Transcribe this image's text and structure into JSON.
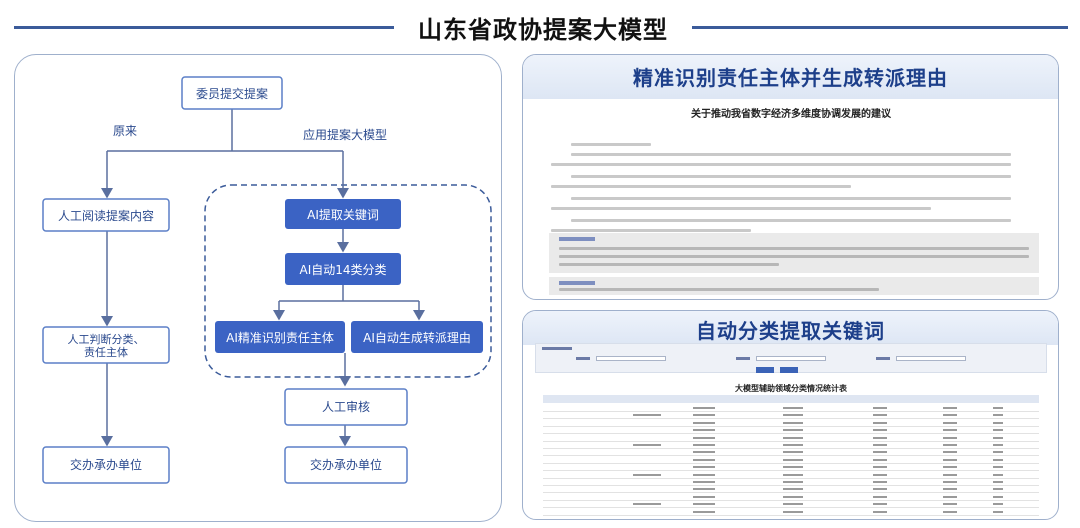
{
  "page_title": "山东省政协提案大模型",
  "flow": {
    "start": "委员提交提案",
    "branch_original": "原来",
    "branch_new": "应用提案大模型",
    "manual_read": "人工阅读提案内容",
    "manual_judge": "人工判断分类、责任主体",
    "ai_keyword": "AI提取关键词",
    "ai_classify": "AI自动14类分类",
    "ai_identify": "AI精准识别责任主体",
    "ai_reason": "AI自动生成转派理由",
    "manual_review": "人工审核",
    "assign_left": "交办承办单位",
    "assign_right": "交办承办单位"
  },
  "panel_top": {
    "title": "精准识别责任主体并生成转派理由",
    "doc_title": "关于推动我省数字经济多维度协调发展的建议"
  },
  "panel_bottom": {
    "title": "自动分类提取关键词",
    "table_title": "大模型辅助领域分类情况统计表"
  },
  "colors": {
    "ai_box": "#3b63c4",
    "manual_box_border": "#5b7fc7",
    "arrow": "#5a6f9f",
    "title_line": "#3b5b9a",
    "panel_title": "#1d3f8a"
  }
}
